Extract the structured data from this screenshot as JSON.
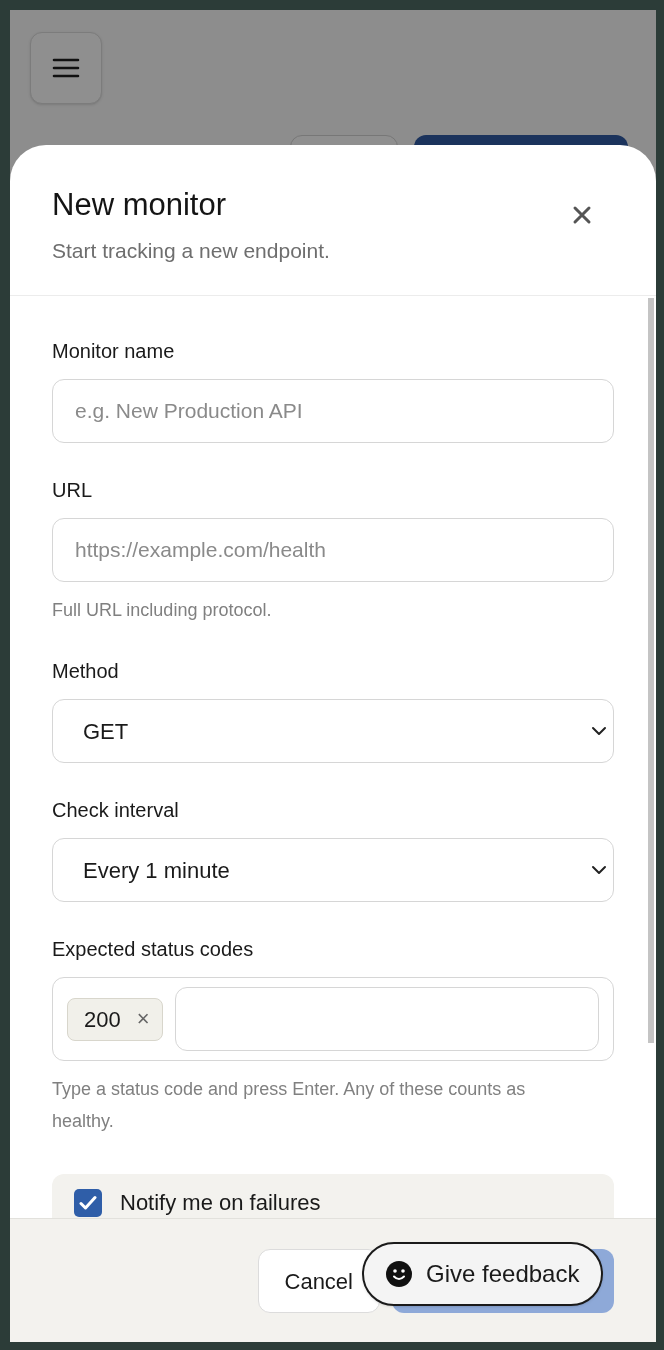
{
  "dialog": {
    "title": "New monitor",
    "subtitle": "Start tracking a new endpoint.",
    "fields": [
      {
        "kind": "text",
        "label": "Monitor name",
        "placeholder": "e.g. New Production API"
      },
      {
        "kind": "text",
        "label": "URL",
        "placeholder": "https://example.com/health",
        "hint": "Full URL including protocol."
      },
      {
        "kind": "select",
        "label": "Method",
        "value": "GET"
      },
      {
        "kind": "select",
        "label": "Check interval",
        "value": "Every 1 minute"
      },
      {
        "kind": "tags",
        "label": "Expected status codes",
        "tags": [
          "200"
        ],
        "remove_mark": "×",
        "hint": "Type a status code and press Enter. Any of these counts as healthy."
      },
      {
        "kind": "checkbox",
        "label": "Notify me on failures",
        "checked": true
      }
    ],
    "cancel_button": "Cancel"
  },
  "feedback_button": {
    "label": "Give feedback"
  }
}
